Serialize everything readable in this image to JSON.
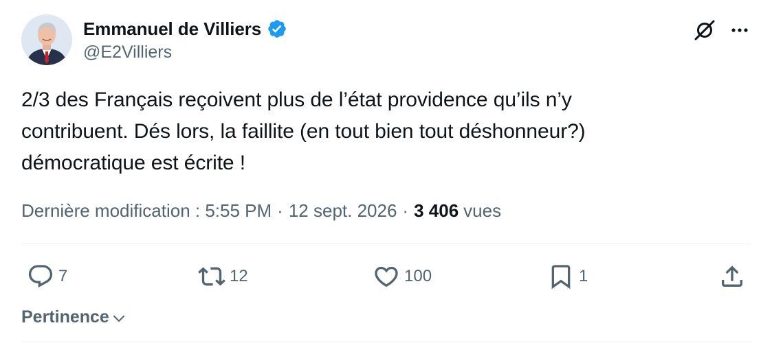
{
  "author": {
    "display_name": "Emmanuel de Villiers",
    "handle": "@E2Villiers",
    "verified": true,
    "verified_color": "#1d9bf0"
  },
  "tweet": {
    "lines": [
      "2/3 des Français reçoivent plus de l’état providence qu’ils n’y",
      "contribuent. Dés lors, la faillite (en tout bien tout déshonneur?)",
      "démocratique est écrite !"
    ]
  },
  "meta": {
    "edited_label": "Dernière modification : 5:55 PM",
    "date": "12 sept. 2026",
    "separator": "·",
    "views_count": "3 406",
    "views_label": "vues"
  },
  "actions": {
    "replies": "7",
    "reposts": "12",
    "likes": "100",
    "bookmarks": "1"
  },
  "sort": {
    "label": "Pertinence"
  },
  "icons": [
    "grok-icon",
    "more-icon",
    "reply-icon",
    "repost-icon",
    "like-icon",
    "bookmark-icon",
    "share-icon",
    "chevron-down-icon"
  ],
  "colors": {
    "text": "#0f1419",
    "secondary": "#536471",
    "divider": "#eff3f4"
  }
}
